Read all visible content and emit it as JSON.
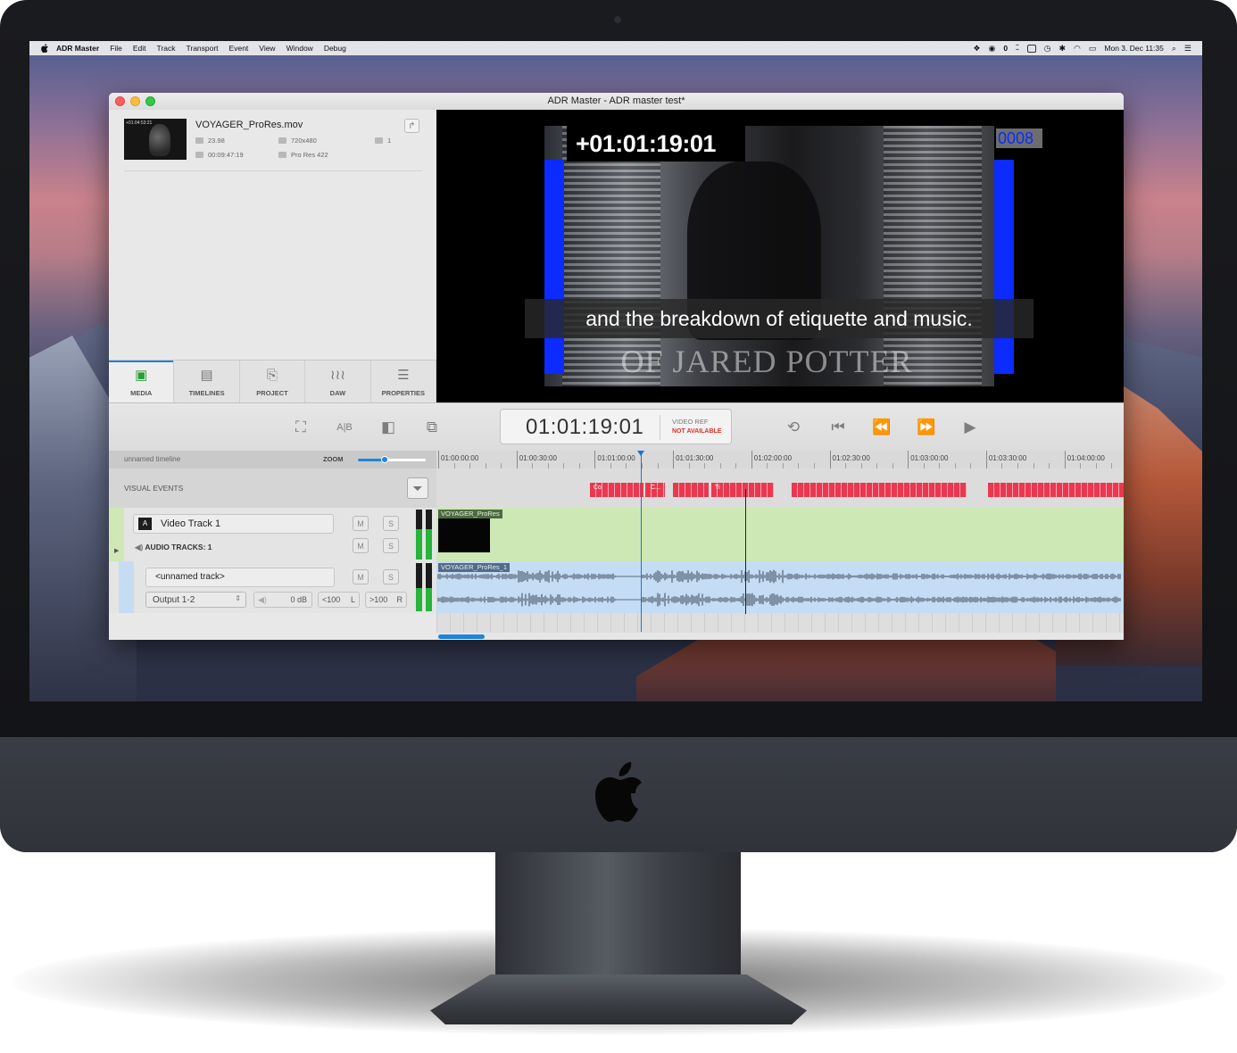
{
  "menubar": {
    "items": [
      "ADR Master",
      "File",
      "Edit",
      "Track",
      "Transport",
      "Event",
      "View",
      "Window",
      "Debug"
    ],
    "status_count": "0",
    "clock": "Mon 3. Dec  11:35"
  },
  "window": {
    "title": "ADR Master - ADR master test*"
  },
  "media": {
    "clip_name": "VOYAGER_ProRes.mov",
    "fps": "23.98",
    "resolution": "720x480",
    "audio_channels": "1",
    "duration": "00:09:47:19",
    "codec": "Pro Res 422"
  },
  "panel_tabs": [
    {
      "label": "MEDIA",
      "icon": "media-icon"
    },
    {
      "label": "TIMELINES",
      "icon": "timelines-icon"
    },
    {
      "label": "PROJECT",
      "icon": "project-icon"
    },
    {
      "label": "DAW",
      "icon": "daw-icon"
    },
    {
      "label": "PROPERTIES",
      "icon": "properties-icon"
    }
  ],
  "viewer": {
    "burned_timecode": "+01:01:19:01",
    "event_counter": "0008",
    "subtitle": "and the breakdown of etiquette and music.",
    "credits_text": "OF JARED POTTER"
  },
  "transport": {
    "timecode": "01:01:19:01",
    "video_ref_label": "VIDEO REF",
    "video_ref_status": "NOT AVAILABLE"
  },
  "timeline": {
    "name": "unnamed timeline",
    "zoom_label": "ZOOM",
    "zoom_level": 0.4,
    "ruler": [
      "01:00:00:00",
      "01:00:30:00",
      "01:01:00:00",
      "01:01:30:00",
      "01:02:00:00",
      "01:02:30:00",
      "01:03:00:00",
      "01:03:30:00",
      "01:04:00:00"
    ],
    "visual_events_label": "VISUAL EVENTS",
    "event_labels": [
      "Co",
      "C...",
      "Ti"
    ],
    "video_track": {
      "badge": "A",
      "name": "Video Track 1",
      "mute": "M",
      "solo": "S",
      "audio_tracks_label": "AUDIO TRACKS: 1",
      "clip_label": "VOYAGER_ProRes"
    },
    "audio_track": {
      "name": "<unnamed track>",
      "mute": "M",
      "solo": "S",
      "output": "Output 1-2",
      "gain": "0 dB",
      "pan_left": "<100",
      "left": "L",
      "pan_right": ">100",
      "right": "R",
      "clip_label": "VOYAGER_ProRes_1"
    }
  },
  "colors": {
    "accent": "#1f84d8",
    "event_red": "#e9384f",
    "video_lane": "#cde8b4",
    "audio_lane": "#c4dcf4",
    "subtitle_marker_blue": "#0b2bff"
  }
}
